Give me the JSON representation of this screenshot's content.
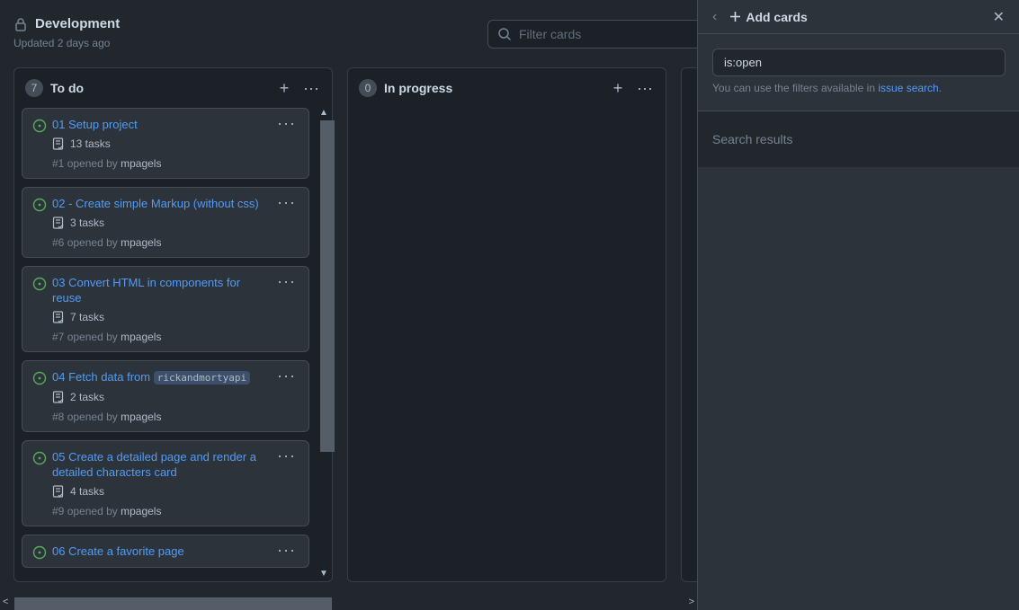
{
  "header": {
    "title": "Development",
    "updated": "Updated 2 days ago"
  },
  "filter": {
    "placeholder": "Filter cards"
  },
  "columns": [
    {
      "name": "To do",
      "count": "7",
      "cards": [
        {
          "title": "01 Setup project",
          "tasks": "13 tasks",
          "number": "#1",
          "opened_by": "opened by",
          "user": "mpagels"
        },
        {
          "title": "02 - Create simple Markup (without css)",
          "tasks": "3 tasks",
          "number": "#6",
          "opened_by": "opened by",
          "user": "mpagels"
        },
        {
          "title": "03 Convert HTML in components for reuse",
          "tasks": "7 tasks",
          "number": "#7",
          "opened_by": "opened by",
          "user": "mpagels"
        },
        {
          "title_prefix": "04 Fetch data from",
          "title_code": "rickandmortyapi",
          "tasks": "2 tasks",
          "number": "#8",
          "opened_by": "opened by",
          "user": "mpagels"
        },
        {
          "title": "05 Create a detailed page and render a detailed characters card",
          "tasks": "4 tasks",
          "number": "#9",
          "opened_by": "opened by",
          "user": "mpagels"
        },
        {
          "title": "06 Create a favorite page"
        }
      ]
    },
    {
      "name": "In progress",
      "count": "0",
      "cards": []
    }
  ],
  "side_panel": {
    "title": "Add cards",
    "search_value": "is:open",
    "hint_prefix": "You can use the filters available in",
    "hint_link": "issue search",
    "hint_suffix": ".",
    "results_label": "Search results"
  },
  "colors": {
    "background": "#22272e",
    "column": "#1c2128",
    "card": "#2d333b",
    "link": "#539bf5",
    "open_status": "#57ab5a"
  },
  "icons": {
    "lock": "lock-icon",
    "search": "search-icon",
    "plus": "plus-icon",
    "kebab": "kebab-horizontal-icon",
    "issue_open": "issue-opened-icon",
    "checklist": "checklist-icon",
    "back": "chevron-left-icon",
    "close": "x-icon"
  }
}
